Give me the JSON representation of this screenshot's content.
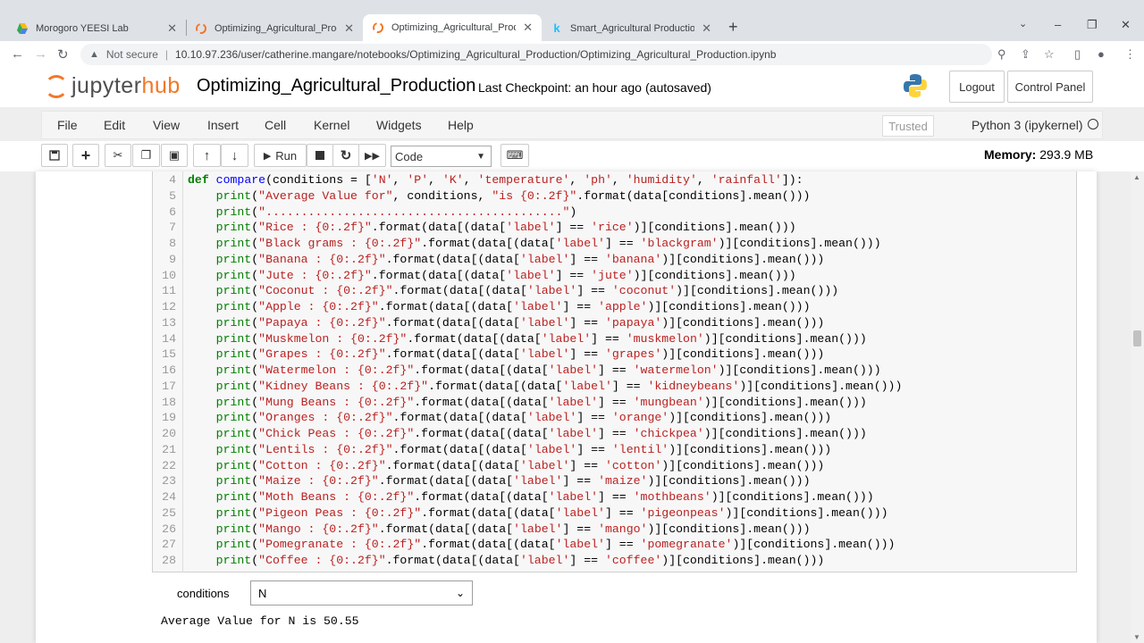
{
  "browser": {
    "tabs": [
      {
        "title": "Morogoro YEESI Lab",
        "favicon": "drive-icon",
        "active": false
      },
      {
        "title": "Optimizing_Agricultural_Production",
        "favicon": "jupyter-icon",
        "active": false
      },
      {
        "title": "Optimizing_Agricultural_Production",
        "favicon": "jupyter-icon",
        "active": true
      },
      {
        "title": "Smart_Agricultural Production Op",
        "favicon": "kaggle-icon",
        "active": false
      }
    ],
    "new_tab": "+",
    "not_secure": "Not secure",
    "url": "10.10.97.236/user/catherine.mangare/notebooks/Optimizing_Agricultural_Production/Optimizing_Agricultural_Production.ipynb"
  },
  "header": {
    "logo_jupyter": "jupyter",
    "logo_hub": "hub",
    "notebook_name": "Optimizing_Agricultural_Production",
    "checkpoint": "Last Checkpoint: an hour ago",
    "autosave": "(autosaved)",
    "logout": "Logout",
    "control_panel": "Control Panel"
  },
  "menubar": {
    "items": [
      "File",
      "Edit",
      "View",
      "Insert",
      "Cell",
      "Kernel",
      "Widgets",
      "Help"
    ],
    "trusted": "Trusted",
    "kernel": "Python 3 (ipykernel)"
  },
  "toolbar": {
    "run_label": "Run",
    "cell_type": "Code",
    "memory_label": "Memory:",
    "memory_value": "293.9 MB"
  },
  "cell": {
    "lines": [
      {
        "n": "4",
        "text": "def compare(conditions = ['N', 'P', 'K', 'temperature', 'ph', 'humidity', 'rainfall']):"
      },
      {
        "n": "5",
        "text": "    print(\"Average Value for\", conditions, \"is {0:.2f}\".format(data[conditions].mean()))"
      },
      {
        "n": "6",
        "text": "    print(\"..........................................\")"
      },
      {
        "n": "7",
        "text": "    print(\"Rice : {0:.2f}\".format(data[(data['label'] == 'rice')][conditions].mean()))"
      },
      {
        "n": "8",
        "text": "    print(\"Black grams : {0:.2f}\".format(data[(data['label'] == 'blackgram')][conditions].mean()))"
      },
      {
        "n": "9",
        "text": "    print(\"Banana : {0:.2f}\".format(data[(data['label'] == 'banana')][conditions].mean()))"
      },
      {
        "n": "10",
        "text": "    print(\"Jute : {0:.2f}\".format(data[(data['label'] == 'jute')][conditions].mean()))"
      },
      {
        "n": "11",
        "text": "    print(\"Coconut : {0:.2f}\".format(data[(data['label'] == 'coconut')][conditions].mean()))"
      },
      {
        "n": "12",
        "text": "    print(\"Apple : {0:.2f}\".format(data[(data['label'] == 'apple')][conditions].mean()))"
      },
      {
        "n": "13",
        "text": "    print(\"Papaya : {0:.2f}\".format(data[(data['label'] == 'papaya')][conditions].mean()))"
      },
      {
        "n": "14",
        "text": "    print(\"Muskmelon : {0:.2f}\".format(data[(data['label'] == 'muskmelon')][conditions].mean()))"
      },
      {
        "n": "15",
        "text": "    print(\"Grapes : {0:.2f}\".format(data[(data['label'] == 'grapes')][conditions].mean()))"
      },
      {
        "n": "16",
        "text": "    print(\"Watermelon : {0:.2f}\".format(data[(data['label'] == 'watermelon')][conditions].mean()))"
      },
      {
        "n": "17",
        "text": "    print(\"Kidney Beans : {0:.2f}\".format(data[(data['label'] == 'kidneybeans')][conditions].mean()))"
      },
      {
        "n": "18",
        "text": "    print(\"Mung Beans : {0:.2f}\".format(data[(data['label'] == 'mungbean')][conditions].mean()))"
      },
      {
        "n": "19",
        "text": "    print(\"Oranges : {0:.2f}\".format(data[(data['label'] == 'orange')][conditions].mean()))"
      },
      {
        "n": "20",
        "text": "    print(\"Chick Peas : {0:.2f}\".format(data[(data['label'] == 'chickpea')][conditions].mean()))"
      },
      {
        "n": "21",
        "text": "    print(\"Lentils : {0:.2f}\".format(data[(data['label'] == 'lentil')][conditions].mean()))"
      },
      {
        "n": "22",
        "text": "    print(\"Cotton : {0:.2f}\".format(data[(data['label'] == 'cotton')][conditions].mean()))"
      },
      {
        "n": "23",
        "text": "    print(\"Maize : {0:.2f}\".format(data[(data['label'] == 'maize')][conditions].mean()))"
      },
      {
        "n": "24",
        "text": "    print(\"Moth Beans : {0:.2f}\".format(data[(data['label'] == 'mothbeans')][conditions].mean()))"
      },
      {
        "n": "25",
        "text": "    print(\"Pigeon Peas : {0:.2f}\".format(data[(data['label'] == 'pigeonpeas')][conditions].mean()))"
      },
      {
        "n": "26",
        "text": "    print(\"Mango : {0:.2f}\".format(data[(data['label'] == 'mango')][conditions].mean()))"
      },
      {
        "n": "27",
        "text": "    print(\"Pomegranate : {0:.2f}\".format(data[(data['label'] == 'pomegranate')][conditions].mean()))"
      },
      {
        "n": "28",
        "text": "    print(\"Coffee : {0:.2f}\".format(data[(data['label'] == 'coffee')][conditions].mean()))"
      }
    ]
  },
  "widget": {
    "label": "conditions",
    "value": "N"
  },
  "output": {
    "first_line": "Average Value for N is 50.55"
  },
  "colors": {
    "jupyter_orange": "#f37726",
    "keyword": "#008000",
    "function": "#0000ff",
    "string": "#ba2121"
  }
}
